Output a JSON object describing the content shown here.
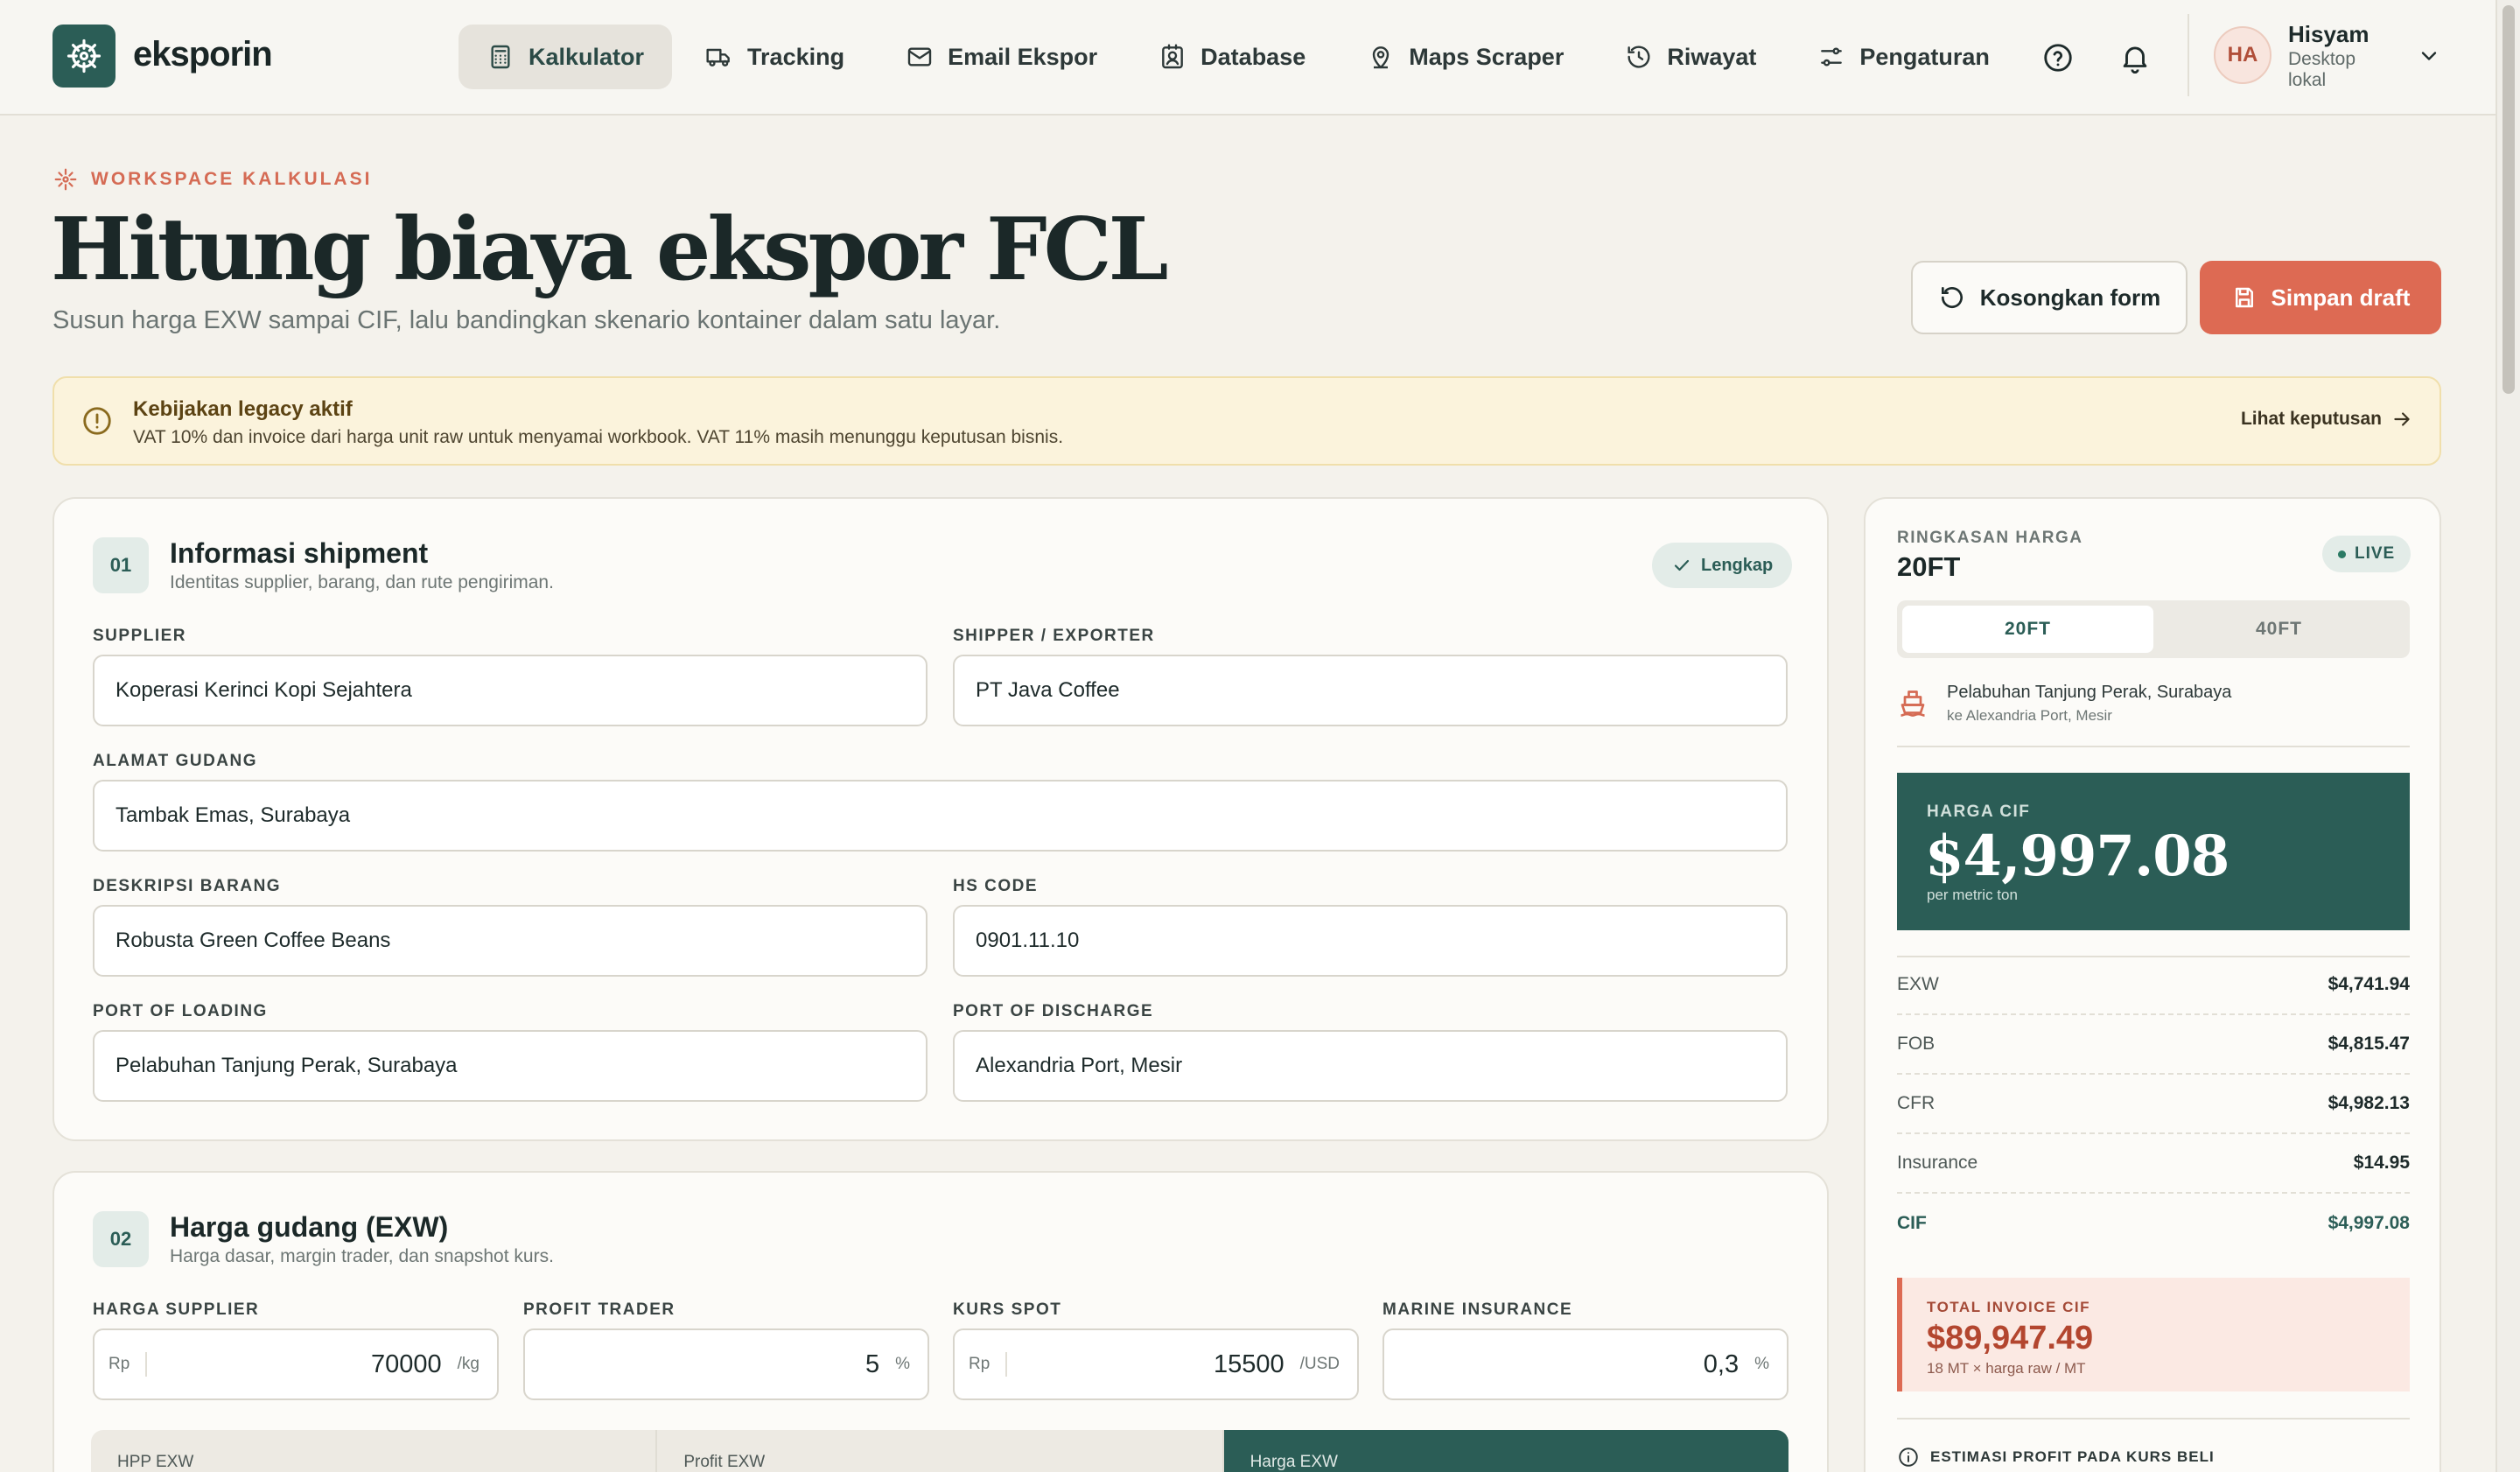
{
  "app": {
    "name": "eksporin"
  },
  "nav": {
    "items": [
      {
        "label": "Kalkulator",
        "icon": "calculator-icon",
        "active": true
      },
      {
        "label": "Tracking",
        "icon": "truck-icon",
        "active": false
      },
      {
        "label": "Email Ekspor",
        "icon": "mail-icon",
        "active": false
      },
      {
        "label": "Database",
        "icon": "contact-icon",
        "active": false
      },
      {
        "label": "Maps Scraper",
        "icon": "map-pin-icon",
        "active": false
      },
      {
        "label": "Riwayat",
        "icon": "history-icon",
        "active": false
      },
      {
        "label": "Pengaturan",
        "icon": "sliders-icon",
        "active": false
      }
    ]
  },
  "user": {
    "initials": "HA",
    "name": "Hisyam",
    "subtitle": "Desktop lokal"
  },
  "header": {
    "eyebrow": "WORKSPACE KALKULASI",
    "title": "Hitung biaya ekspor FCL",
    "subtitle": "Susun harga EXW sampai CIF, lalu bandingkan skenario kontainer dalam satu layar.",
    "reset_label": "Kosongkan form",
    "save_label": "Simpan draft"
  },
  "alert": {
    "title": "Kebijakan legacy aktif",
    "text": "VAT 10% dan invoice dari harga unit raw untuk menyamai workbook. VAT 11% masih menunggu keputusan bisnis.",
    "link": "Lihat keputusan"
  },
  "shipment": {
    "step": "01",
    "title": "Informasi shipment",
    "desc": "Identitas supplier, barang, dan rute pengiriman.",
    "status": "Lengkap",
    "fields": {
      "supplier": {
        "label": "SUPPLIER",
        "value": "Koperasi Kerinci Kopi Sejahtera"
      },
      "shipper": {
        "label": "SHIPPER / EXPORTER",
        "value": "PT Java Coffee"
      },
      "warehouse": {
        "label": "ALAMAT GUDANG",
        "value": "Tambak Emas, Surabaya"
      },
      "goods": {
        "label": "DESKRIPSI BARANG",
        "value": "Robusta Green Coffee Beans"
      },
      "hs_code": {
        "label": "HS CODE",
        "value": "0901.11.10"
      },
      "pol": {
        "label": "PORT OF LOADING",
        "value": "Pelabuhan Tanjung Perak, Surabaya"
      },
      "pod": {
        "label": "PORT OF DISCHARGE",
        "value": "Alexandria Port, Mesir"
      }
    }
  },
  "exw": {
    "step": "02",
    "title": "Harga gudang (EXW)",
    "desc": "Harga dasar, margin trader, dan snapshot kurs.",
    "fields": {
      "supplier_price": {
        "label": "HARGA SUPPLIER",
        "prefix": "Rp",
        "value": "70000",
        "suffix": "/kg"
      },
      "profit": {
        "label": "PROFIT TRADER",
        "value": "5",
        "suffix": "%"
      },
      "fx": {
        "label": "KURS SPOT",
        "prefix": "Rp",
        "value": "15500",
        "suffix": "/USD"
      },
      "insurance": {
        "label": "MARINE INSURANCE",
        "value": "0,3",
        "suffix": "%"
      }
    },
    "strip": [
      "HPP EXW",
      "Profit EXW",
      "Harga EXW"
    ]
  },
  "summary": {
    "label": "RINGKASAN HARGA",
    "title": "20FT",
    "live": "LIVE",
    "tabs": [
      {
        "label": "20FT",
        "active": true
      },
      {
        "label": "40FT",
        "active": false
      }
    ],
    "route_main": "Pelabuhan Tanjung Perak, Surabaya",
    "route_sub": "ke Alexandria Port, Mesir",
    "cif_label": "HARGA CIF",
    "cif_value": "$4,997.08",
    "cif_sub": "per metric ton",
    "rows": [
      {
        "k": "EXW",
        "v": "$4,741.94"
      },
      {
        "k": "FOB",
        "v": "$4,815.47"
      },
      {
        "k": "CFR",
        "v": "$4,982.13"
      },
      {
        "k": "Insurance",
        "v": "$14.95"
      },
      {
        "k": "CIF",
        "v": "$4,997.08"
      }
    ],
    "invoice_label": "TOTAL INVOICE CIF",
    "invoice_value": "$89,947.49",
    "invoice_sub": "18 MT × harga raw / MT",
    "estimate_label": "ESTIMASI PROFIT PADA KURS BELI"
  },
  "colors": {
    "brand": "#2b5d56",
    "accent": "#dd6a53",
    "background": "#f4f2ec",
    "alert_bg": "#fbf3dc"
  }
}
